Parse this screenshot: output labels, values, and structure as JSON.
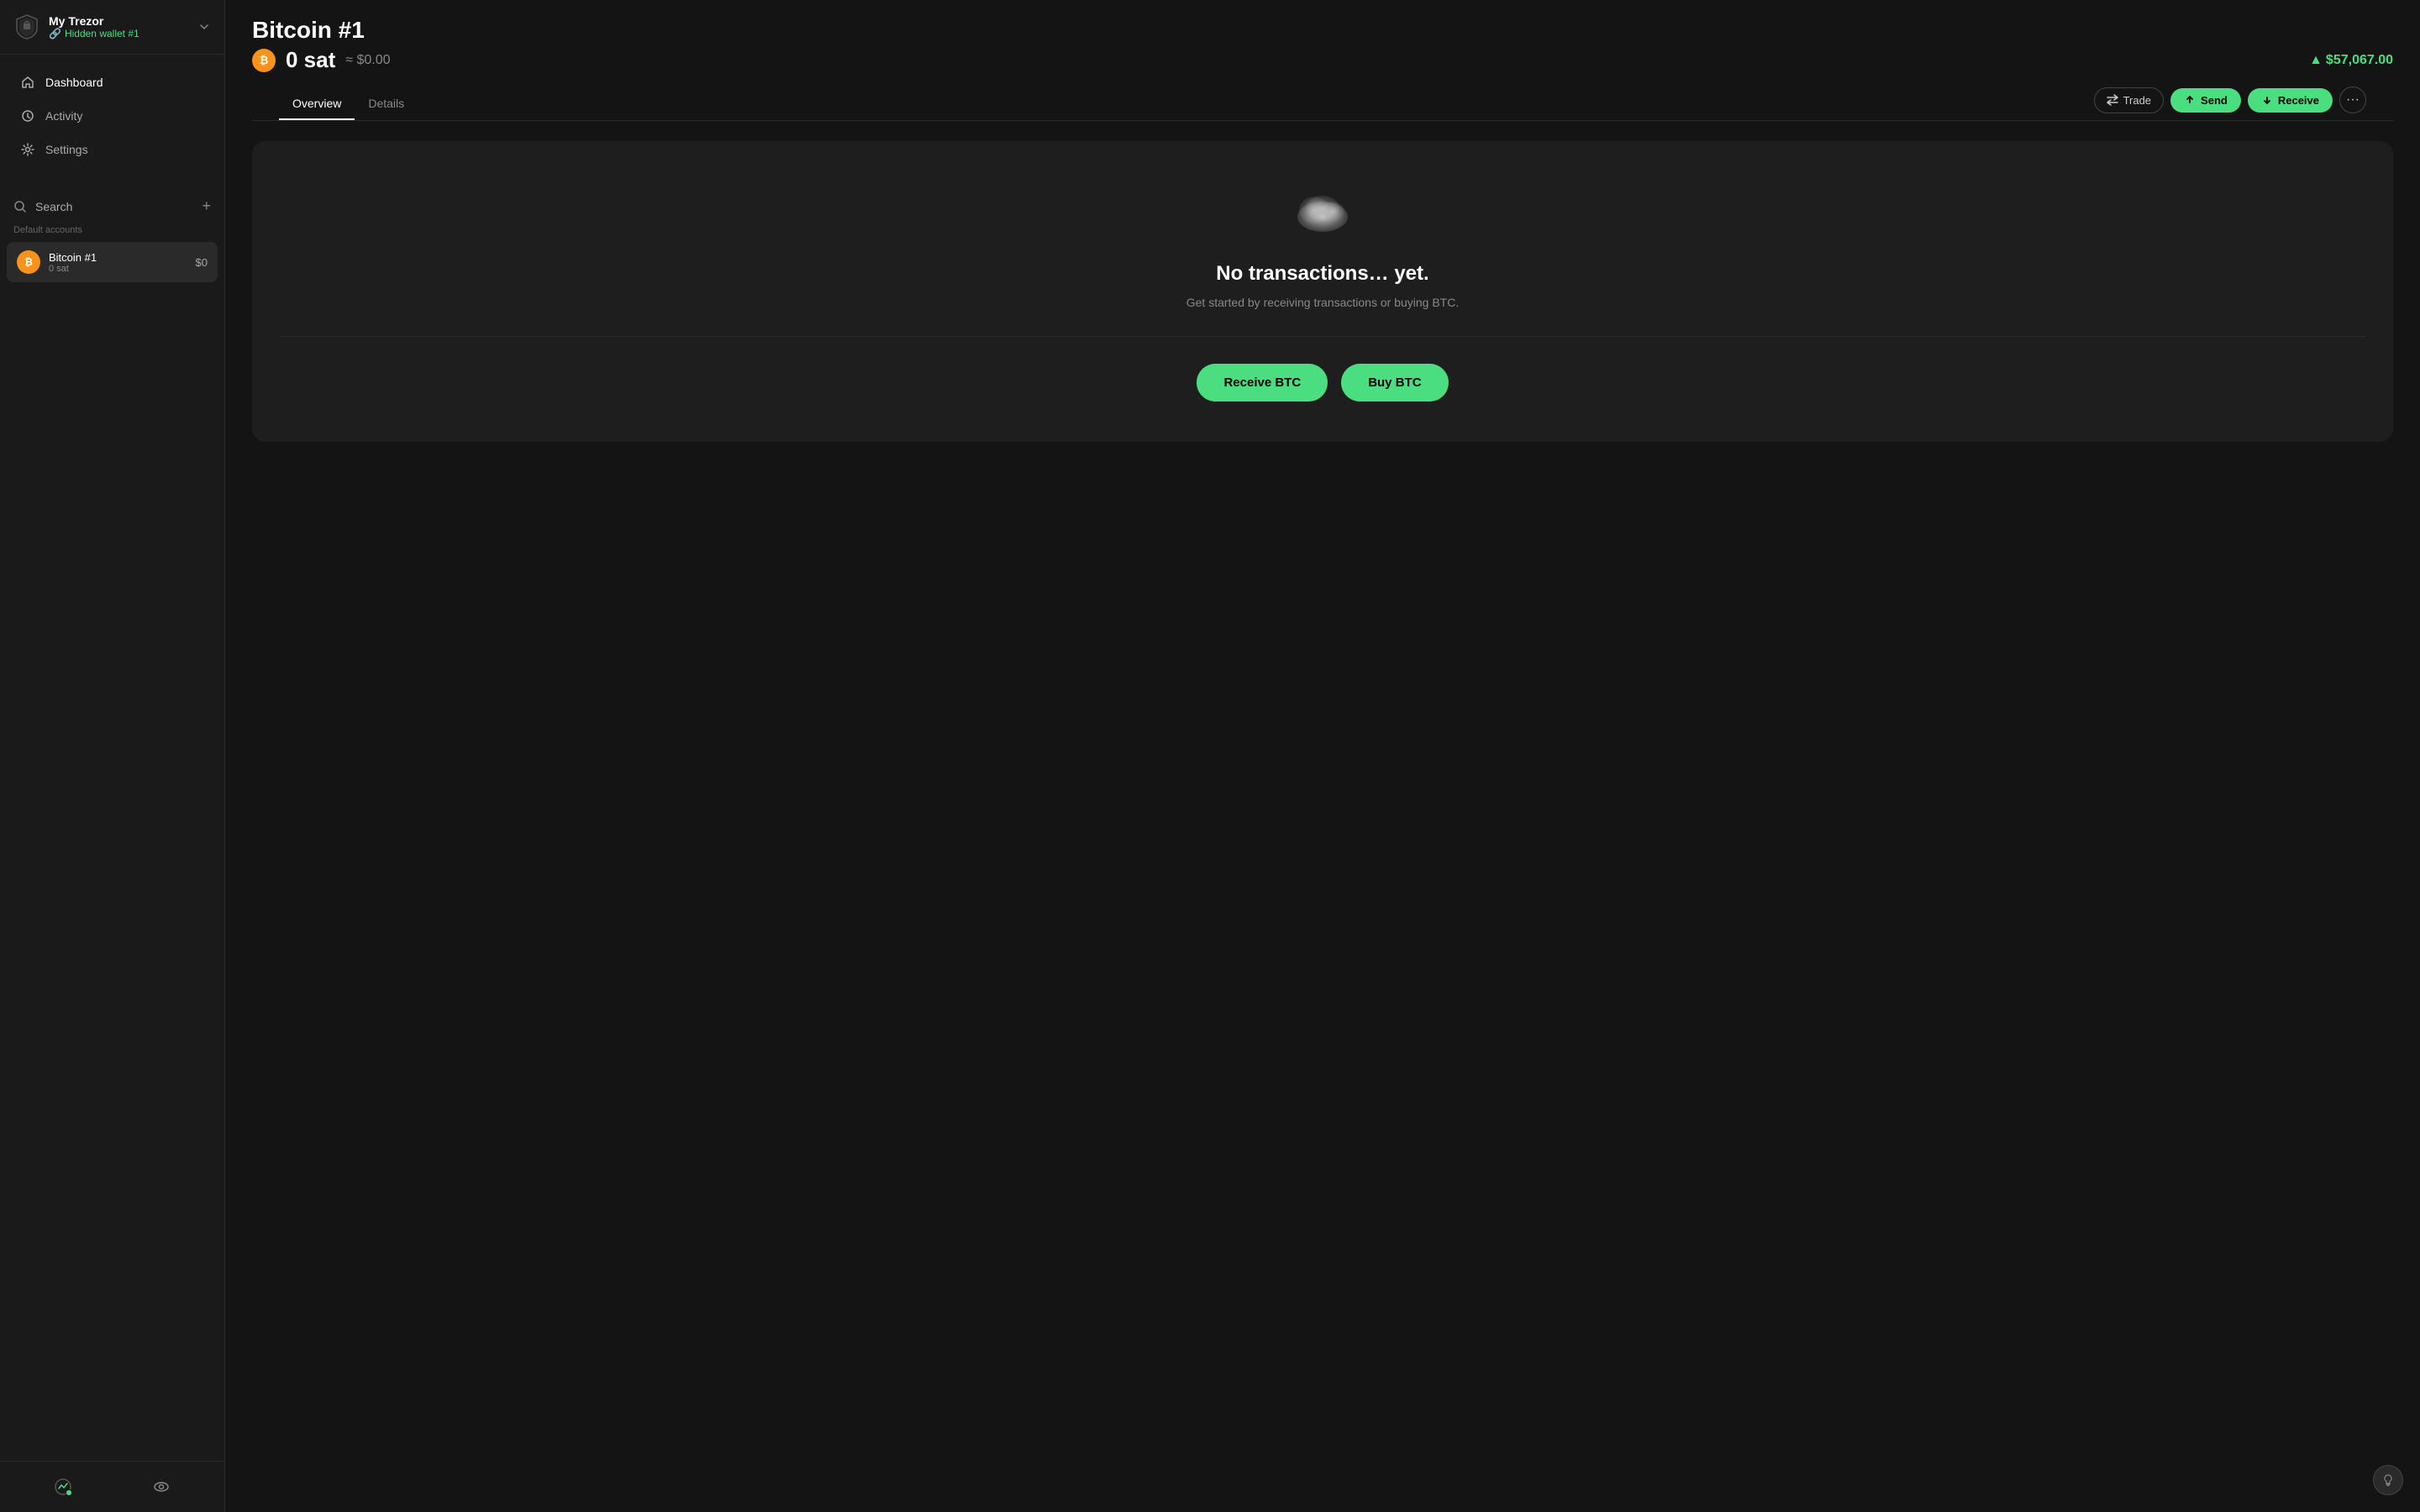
{
  "sidebar": {
    "wallet_name": "My Trezor",
    "wallet_subtitle": "Hidden wallet #1",
    "nav_items": [
      {
        "id": "dashboard",
        "label": "Dashboard"
      },
      {
        "id": "activity",
        "label": "Activity"
      },
      {
        "id": "settings",
        "label": "Settings"
      }
    ],
    "search_label": "Search",
    "add_icon_title": "+",
    "default_accounts_label": "Default accounts",
    "accounts": [
      {
        "id": "bitcoin1",
        "name": "Bitcoin #1",
        "balance": "0 sat",
        "value": "$0",
        "icon_text": "₿"
      }
    ]
  },
  "header": {
    "title": "Bitcoin #1",
    "balance_amount": "0 sat",
    "balance_fiat": "≈ $0.00",
    "price": "$57,067.00",
    "price_trend": "up"
  },
  "tabs": [
    {
      "id": "overview",
      "label": "Overview",
      "active": true
    },
    {
      "id": "details",
      "label": "Details",
      "active": false
    }
  ],
  "actions": {
    "trade_label": "Trade",
    "send_label": "Send",
    "receive_label": "Receive",
    "more_icon": "•••"
  },
  "empty_state": {
    "title": "No transactions… yet.",
    "subtitle": "Get started by receiving transactions or buying BTC.",
    "cta_receive": "Receive BTC",
    "cta_buy": "Buy BTC"
  },
  "footer": {
    "stats_icon": "chart",
    "eye_icon": "eye"
  },
  "help_btn_label": "?"
}
